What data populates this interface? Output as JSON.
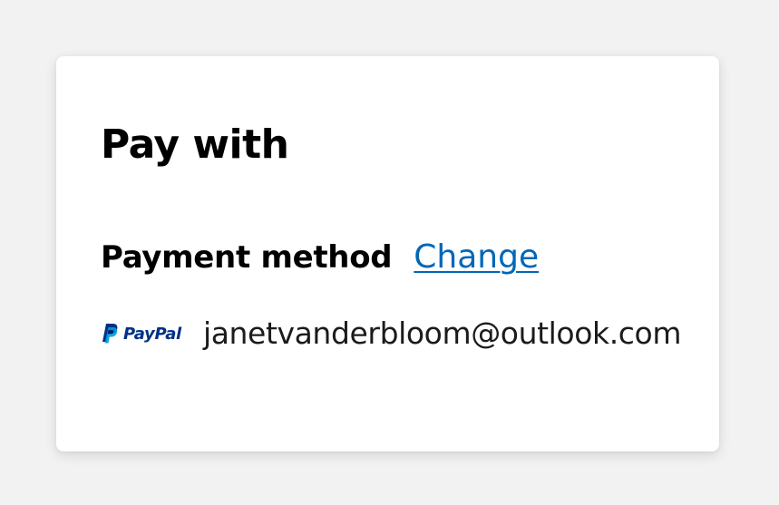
{
  "card": {
    "title": "Pay with"
  },
  "payment_method": {
    "label": "Payment method",
    "change_label": "Change",
    "provider": {
      "name": "PayPal",
      "icon": "paypal-icon",
      "brand_colors": {
        "dark": "#003087",
        "light": "#009cde"
      }
    },
    "account": "janetvanderbloom@outlook.com"
  },
  "colors": {
    "background": "#f2f2f2",
    "card": "#ffffff",
    "link": "#0067b8",
    "text": "#000000"
  }
}
